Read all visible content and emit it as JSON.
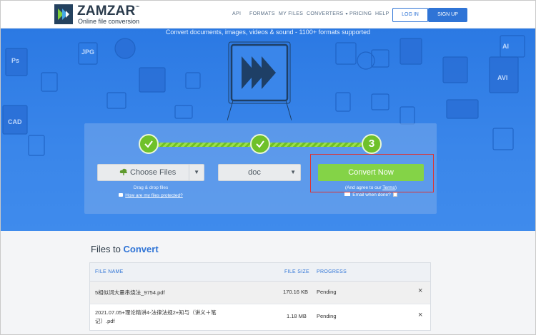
{
  "header": {
    "logo_name": "ZAMZAR",
    "logo_tm": "™",
    "logo_tagline": "Online file conversion",
    "nav": {
      "api": "API",
      "formats": "FORMATS",
      "my_files": "MY FILES",
      "converters": "CONVERTERS",
      "pricing": "PRICING",
      "help": "HELP"
    },
    "login": "LOG IN",
    "signup": "SIGN UP"
  },
  "hero": {
    "tagline": "Convert documents, images, videos & sound - 1100+ formats supported",
    "steps": [
      "✓",
      "✓",
      "3"
    ],
    "choose_files": "Choose Files",
    "drag_hint": "Drag & drop files",
    "protected_link": "How are my files protected?",
    "format_value": "doc",
    "convert_now": "Convert Now",
    "agree_prefix": "(And agree to our ",
    "agree_terms": "Terms",
    "agree_suffix": ")",
    "email_label": "Email when done?"
  },
  "files": {
    "title_prefix": "Files to",
    "title_highlight": "Convert",
    "columns": {
      "name": "FILE NAME",
      "size": "FILE SIZE",
      "progress": "PROGRESS"
    },
    "rows": [
      {
        "name_line1": "5相似词大量串烧法_9754.pdf",
        "name_line2": "",
        "size": "170.16 KB",
        "progress": "Pending",
        "remove": "×"
      },
      {
        "name_line1": "2021.07.05+理论精讲4-法律法规2+知与（讲义＋笔",
        "name_line2": "记）.pdf",
        "size": "1.18 MB",
        "progress": "Pending",
        "remove": "×"
      }
    ]
  },
  "colors": {
    "brand_blue": "#2f74d6",
    "hero_blue": "#2b79e3",
    "convert_green": "#84d347",
    "highlight_red": "#dd3333"
  },
  "icons": [
    "zamzar-logo-icon",
    "cloud-upload-icon",
    "lock-icon",
    "envelope-icon",
    "checkmark-icon",
    "close-icon",
    "caret-down-icon"
  ]
}
